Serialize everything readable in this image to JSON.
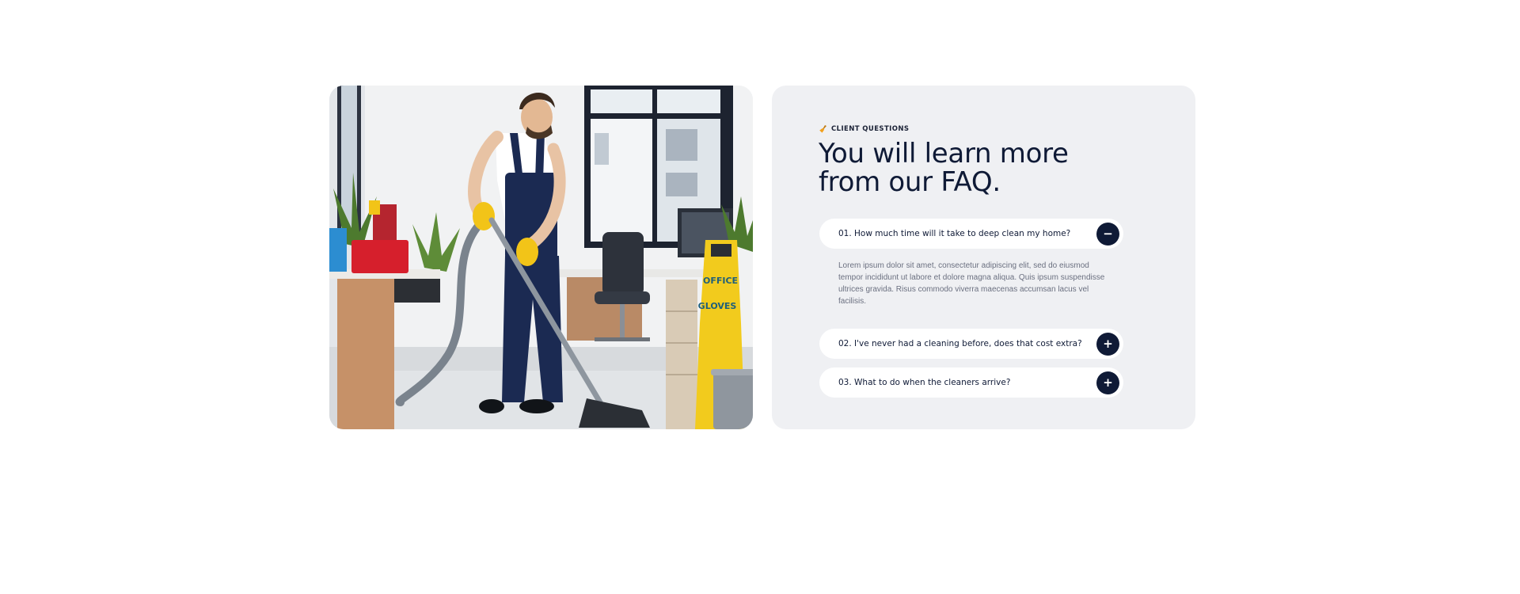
{
  "image": {
    "alt": "Cleaner in overalls vacuuming an office floor",
    "sign_lines": [
      "OFFICE",
      "GLOVES"
    ]
  },
  "faq": {
    "eyebrow": "CLIENT QUESTIONS",
    "eyebrow_icon": "broom-icon",
    "title": "You will learn more from our FAQ.",
    "items": [
      {
        "question": "01. How much time will it take to deep clean my home?",
        "toggle": "−",
        "expanded": true,
        "answer": "Lorem ipsum dolor sit amet, consectetur adipiscing elit, sed do eiusmod tempor incididunt ut labore et dolore magna aliqua. Quis ipsum suspendisse ultrices gravida. Risus commodo viverra maecenas accumsan lacus vel facilisis."
      },
      {
        "question": "02. I've never had a cleaning before, does that cost extra?",
        "toggle": "+",
        "expanded": false
      },
      {
        "question": "03. What to do when the cleaners arrive?",
        "toggle": "+",
        "expanded": false
      }
    ]
  },
  "colors": {
    "navy": "#0f1a36",
    "card_bg": "#eff0f3",
    "accent_orange": "#f2a01c",
    "text_muted": "#6b7080"
  }
}
